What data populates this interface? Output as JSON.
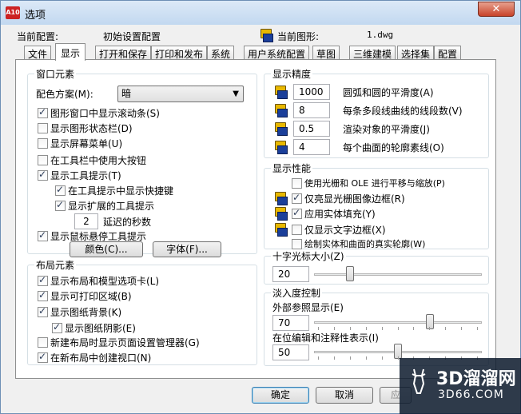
{
  "window": {
    "title": "选项",
    "close_glyph": "✕",
    "app_icon_text": "A10"
  },
  "header": {
    "current_config_label": "当前配置:",
    "current_config_value": "初始设置配置",
    "current_drawing_label": "当前图形:",
    "current_drawing_value": "1.dwg"
  },
  "tabs": [
    "文件",
    "显示",
    "打开和保存",
    "打印和发布",
    "系统",
    "用户系统配置",
    "草图",
    "三维建模",
    "选择集",
    "配置"
  ],
  "active_tab": "显示",
  "window_elements": {
    "title": "窗口元素",
    "color_scheme_label": "配色方案(M):",
    "color_scheme_value": "暗",
    "checkboxes": [
      {
        "label": "图形窗口中显示滚动条(S)",
        "checked": true
      },
      {
        "label": "显示图形状态栏(D)",
        "checked": false
      },
      {
        "label": "显示屏幕菜单(U)",
        "checked": false
      },
      {
        "label": "在工具栏中使用大按钮",
        "checked": false
      },
      {
        "label": "显示工具提示(T)",
        "checked": true
      },
      {
        "label": "在工具提示中显示快捷键",
        "checked": true
      },
      {
        "label": "显示扩展的工具提示",
        "checked": true
      },
      {
        "label": "显示鼠标悬停工具提示",
        "checked": true
      }
    ],
    "delay_value": "2",
    "delay_label": "延迟的秒数",
    "colors_button": "颜色(C)...",
    "fonts_button": "字体(F)..."
  },
  "layout_elements": {
    "title": "布局元素",
    "checkboxes": [
      {
        "label": "显示布局和模型选项卡(L)",
        "checked": true
      },
      {
        "label": "显示可打印区域(B)",
        "checked": true
      },
      {
        "label": "显示图纸背景(K)",
        "checked": true
      },
      {
        "label": "显示图纸阴影(E)",
        "checked": true
      },
      {
        "label": "新建布局时显示页面设置管理器(G)",
        "checked": false
      },
      {
        "label": "在新布局中创建视口(N)",
        "checked": true
      }
    ]
  },
  "display_resolution": {
    "title": "显示精度",
    "rows": [
      {
        "value": "1000",
        "label": "圆弧和圆的平滑度(A)"
      },
      {
        "value": "8",
        "label": "每条多段线曲线的线段数(V)"
      },
      {
        "value": "0.5",
        "label": "渲染对象的平滑度(J)"
      },
      {
        "value": "4",
        "label": "每个曲面的轮廓素线(O)"
      }
    ]
  },
  "display_performance": {
    "title": "显示性能",
    "checkboxes": [
      {
        "label": "使用光栅和 OLE 进行平移与缩放(P)",
        "checked": false
      },
      {
        "label": "仅亮显光栅图像边框(R)",
        "checked": true
      },
      {
        "label": "应用实体填充(Y)",
        "checked": true
      },
      {
        "label": "仅显示文字边框(X)",
        "checked": false
      },
      {
        "label": "绘制实体和曲面的真实轮廓(W)",
        "checked": false
      }
    ]
  },
  "crosshair": {
    "title": "十字光标大小(Z)",
    "value": "20",
    "level": 20
  },
  "fade_control": {
    "title": "淡入度控制",
    "xref_label": "外部参照显示(E)",
    "xref_value": "70",
    "xref_level": 70,
    "inplace_label": "在位编辑和注释性表示(I)",
    "inplace_value": "50",
    "inplace_level": 50
  },
  "footer": {
    "ok_button": "确定",
    "cancel_button": "取消",
    "apply_button": "应"
  },
  "watermark": {
    "brand": "3D溜溜网",
    "url": "3D66.COM"
  },
  "icons": {
    "close": "close-icon",
    "drawing": "drawing-file-icon",
    "saved_in_drawing": "saved-in-drawing-icon",
    "dropdown": "chevron-down-icon"
  },
  "colors": {
    "title_bar": "#c2d8f0",
    "close_button": "#c7432a",
    "default_button_border": "#3c7fb1",
    "group_border": "#d5dfe5"
  }
}
